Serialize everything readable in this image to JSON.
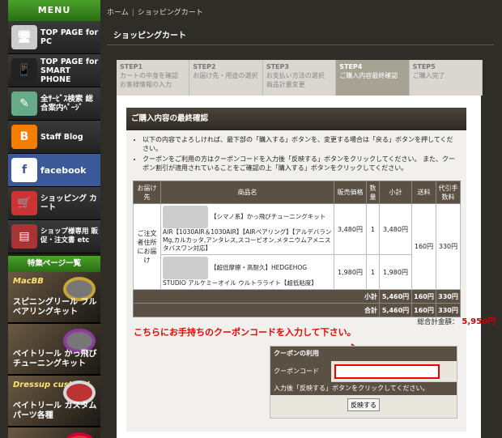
{
  "sidebar": {
    "menu": "MENU",
    "items": [
      {
        "label": "TOP PAGE for PC",
        "icon": "monitor-icon"
      },
      {
        "label": "TOP PAGE for SMART PHONE",
        "icon": "smartphone-icon"
      },
      {
        "label": "全ｻｰﾋﾞｽ検索 総合案内ﾍﾟｰｼﾞ",
        "icon": "compass-icon"
      },
      {
        "label": "Staff Blog",
        "icon": "blogger-icon"
      },
      {
        "label": "facebook",
        "icon": "facebook-icon"
      },
      {
        "label": "ショッピング カート",
        "icon": "cart-icon"
      },
      {
        "label": "ショップ様専用 販促・注文書 etc",
        "icon": "shop-icon"
      }
    ],
    "special": "特集ページ一覧",
    "banners": [
      {
        "label": "スピニングリール フルベアリングキット",
        "tag": "MacBB"
      },
      {
        "label": "ベイトリール かっ飛びチューニングキット",
        "tag": ""
      },
      {
        "label": "ベイトリール カスタムパーツ各種",
        "tag": "Dressup custom!"
      },
      {
        "label": "",
        "tag": ""
      }
    ]
  },
  "breadcrumb": {
    "home": "ホーム",
    "sep": "|",
    "current": "ショッピングカート"
  },
  "title": "ショッピングカート",
  "steps": [
    {
      "n": "STEP1",
      "t": "カートの中身を確認 お客様情報の入力"
    },
    {
      "n": "STEP2",
      "t": "お届け先・用途の選択"
    },
    {
      "n": "STEP3",
      "t": "お支払い方法の選択 商品計量変更"
    },
    {
      "n": "STEP4",
      "t": "ご購入内容最終確認"
    },
    {
      "n": "STEP5",
      "t": "ご購入完了"
    }
  ],
  "section": "ご購入内容の最終確認",
  "notes": [
    "以下の内容でよろしければ、最下部の「購入する」ボタンを、変更する場合は「戻る」ボタンを押してください。",
    "クーポンをご利用の方はクーポンコードを入力後「反映する」ボタンをクリックしてください。 また、クーポン割引が適用されていることをご確認の上「購入する」ボタンをクリックしてください。"
  ],
  "table": {
    "headers": [
      "お届け先",
      "商品名",
      "販売価格",
      "数量",
      "小計",
      "送料",
      "代引手数料"
    ],
    "dest": "ご注文者住所にお届け",
    "rows": [
      {
        "name": "【シマノ系】かっ飛びチューニングキットAIR【1030AIR＆1030AIR】【AIRベアリング】【アルデバランMg,カルカッタ,アンタレス,スコーピオン,メタニウムアメニスタバスワン対応】",
        "price": "3,480円",
        "qty": "1",
        "sub": "3,480円"
      },
      {
        "name": "【超低摩擦・高耐久】HEDGEHOG STUDIO アルケミーオイル ウルトラライト【超低粘度】",
        "price": "1,980円",
        "qty": "1",
        "sub": "1,980円"
      }
    ],
    "ship": "160円",
    "cod": "330円",
    "subtotal": {
      "label": "小計",
      "v": "5,460円",
      "ship": "160円",
      "cod": "330円"
    },
    "total": {
      "label": "合計",
      "v": "5,460円",
      "ship": "160円",
      "cod": "330円"
    }
  },
  "grand": {
    "label": "総合計金額：",
    "v": "5,950円"
  },
  "callout": "こちらにお手持ちのクーポンコードを入力して下さい。",
  "coupon": {
    "head": "クーポンの利用",
    "code_label": "クーポンコード",
    "hint": "入力後「反映する」ボタンをクリックしてください。",
    "apply": "反映する",
    "value": ""
  }
}
